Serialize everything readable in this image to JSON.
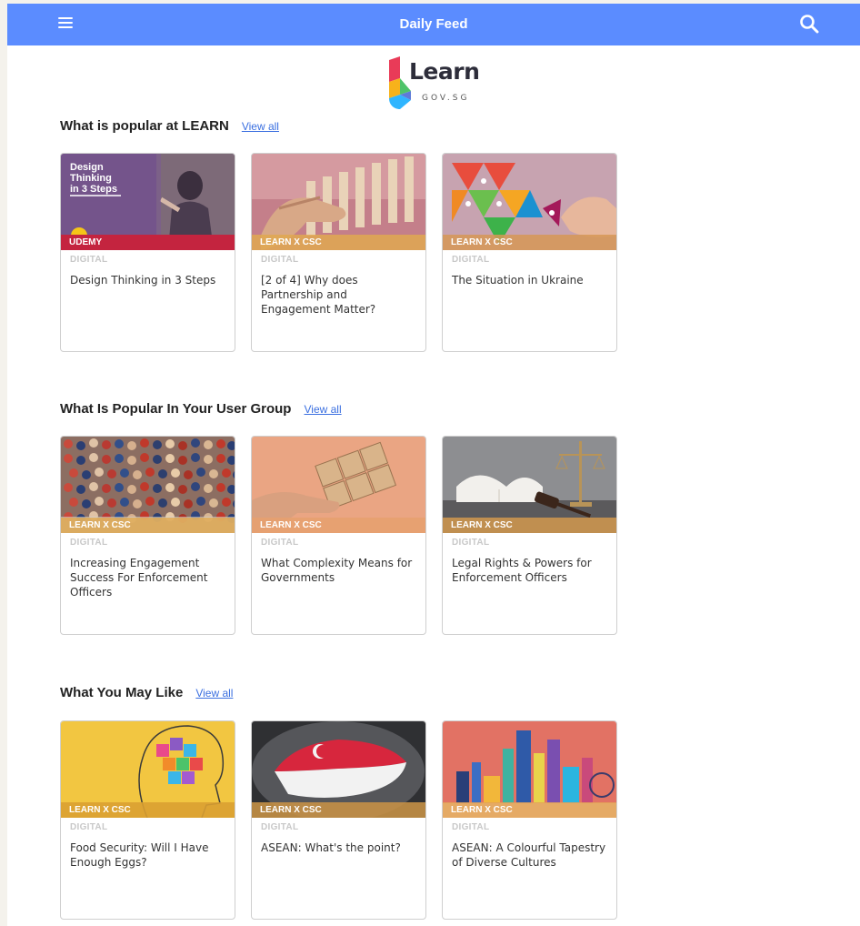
{
  "header": {
    "title": "Daily Feed",
    "background": "#5b8cff"
  },
  "logo": {
    "word": "Learn",
    "sub": "GOV.SG"
  },
  "sections": [
    {
      "title": "What is popular at LEARN",
      "view_all": "View all",
      "cards": [
        {
          "provider": "UDEMY",
          "category": "DIGITAL",
          "title": "Design Thinking in 3 Steps",
          "thumb_text": "Design Thinking in 3 Steps"
        },
        {
          "provider": "LEARN X CSC",
          "category": "DIGITAL",
          "title": "[2 of 4] Why does Partnership and Engagement Matter?"
        },
        {
          "provider": "LEARN X CSC",
          "category": "DIGITAL",
          "title": "The Situation in Ukraine"
        }
      ]
    },
    {
      "title": "What Is Popular In Your User Group",
      "view_all": "View all",
      "cards": [
        {
          "provider": "LEARN X CSC",
          "category": "DIGITAL",
          "title": "Increasing Engagement Success For Enforcement Officers"
        },
        {
          "provider": "LEARN X CSC",
          "category": "DIGITAL",
          "title": "What Complexity Means for Governments"
        },
        {
          "provider": "LEARN X CSC",
          "category": "DIGITAL",
          "title": "Legal Rights & Powers for Enforcement Officers"
        }
      ]
    },
    {
      "title": "What You May Like",
      "view_all": "View all",
      "cards": [
        {
          "provider": "LEARN X CSC",
          "category": "DIGITAL",
          "title": "Food Security: Will I Have Enough Eggs?"
        },
        {
          "provider": "LEARN X CSC",
          "category": "DIGITAL",
          "title": "ASEAN: What's the point?"
        },
        {
          "provider": "LEARN X CSC",
          "category": "DIGITAL",
          "title": "ASEAN: A Colourful Tapestry of Diverse Cultures"
        }
      ]
    }
  ],
  "icons": {
    "menu": "menu-icon",
    "search": "search-icon"
  }
}
